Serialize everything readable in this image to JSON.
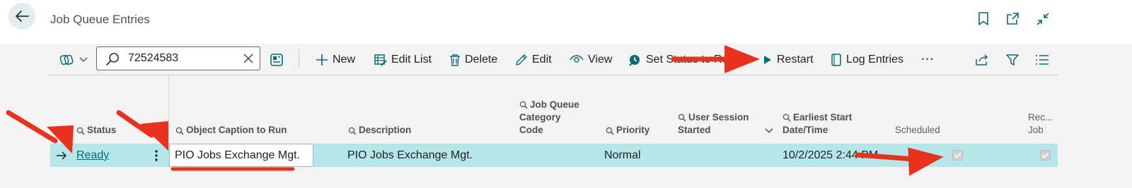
{
  "header": {
    "title": "Job Queue Entries",
    "icons": [
      "back-arrow-icon",
      "bookmark-icon",
      "open-new-window-icon",
      "collapse-icon"
    ]
  },
  "toolbar": {
    "search_value": "72524583",
    "new_label": "New",
    "edit_list_label": "Edit List",
    "delete_label": "Delete",
    "edit_label": "Edit",
    "view_label": "View",
    "set_status_label": "Set Status to Re",
    "restart_label": "Restart",
    "log_entries_label": "Log Entries",
    "more_label": "···"
  },
  "columns": {
    "status": "Status",
    "object_caption": "Object Caption to Run",
    "description": "Description",
    "category_line1": "Job Queue",
    "category_line2": "Category",
    "category_line3": "Code",
    "priority": "Priority",
    "user_session_line1": "User Session",
    "user_session_line2": "Started",
    "earliest_start_line1": "Earliest Start",
    "earliest_start_line2": "Date/Time",
    "scheduled": "Scheduled",
    "recurring_line1": "Rec...",
    "recurring_line2": "Job"
  },
  "rows": [
    {
      "status": "Ready",
      "object_caption": "PIO Jobs Exchange Mgt.",
      "description": "PIO Jobs Exchange Mgt.",
      "priority": "Normal",
      "earliest_start": "10/2/2025 2:44 PM",
      "scheduled": true,
      "recurring": true
    }
  ],
  "colors": {
    "accent_teal": "#0a6b78",
    "selected_row": "#b4e6ea",
    "annotation_red": "#e8321e"
  }
}
